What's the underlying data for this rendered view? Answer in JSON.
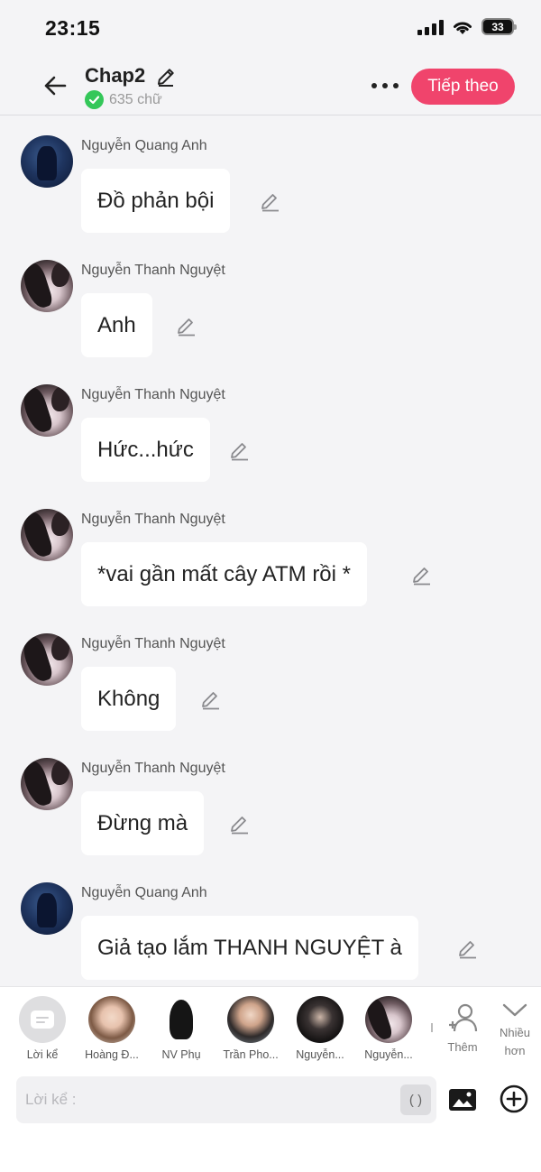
{
  "status_bar": {
    "time": "23:15",
    "battery": "33"
  },
  "header": {
    "title": "Chap2",
    "word_count": "635 chữ",
    "next_label": "Tiếp theo"
  },
  "messages": [
    {
      "sender": "Nguyễn Quang Anh",
      "text": "Đồ phản bội",
      "avatar": "blue"
    },
    {
      "sender": "Nguyễn Thanh Nguyệt",
      "text": "Anh",
      "avatar": "girl"
    },
    {
      "sender": "Nguyễn Thanh Nguyệt",
      "text": "Hức...hức",
      "avatar": "girl"
    },
    {
      "sender": "Nguyễn Thanh Nguyệt",
      "text": "*vai gần mất cây ATM rồi *",
      "avatar": "girl"
    },
    {
      "sender": "Nguyễn Thanh Nguyệt",
      "text": "Không",
      "avatar": "girl"
    },
    {
      "sender": "Nguyễn Thanh Nguyệt",
      "text": "Đừng mà",
      "avatar": "girl"
    },
    {
      "sender": "Nguyễn Quang Anh",
      "text": "Giả tạo lắm THANH NGUYỆT à",
      "avatar": "blue"
    }
  ],
  "characters": [
    {
      "label": "Lời kể"
    },
    {
      "label": "Hoàng Đ..."
    },
    {
      "label": "NV Phụ"
    },
    {
      "label": "Trần Pho..."
    },
    {
      "label": "Nguyễn..."
    },
    {
      "label": "Nguyễn..."
    }
  ],
  "add_character_label": "Thêm",
  "more_label_1": "Nhiều",
  "more_label_2": "hơn",
  "input": {
    "placeholder": "Lời kể :",
    "value": "",
    "paren_label": "( )"
  }
}
